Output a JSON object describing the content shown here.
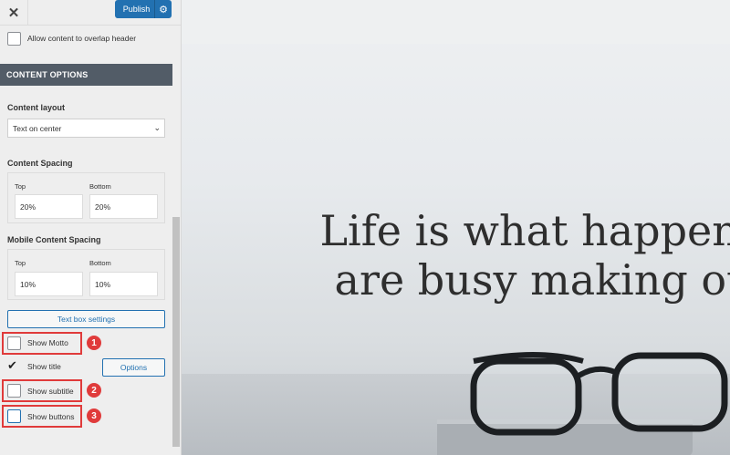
{
  "topbar": {
    "close_icon": "close-icon",
    "close_symbol": "✕",
    "publish_label": "Publish",
    "settings_icon": "gear-icon",
    "settings_symbol": "⚙"
  },
  "overlap_checkbox": {
    "label": "Allow content to overlap header",
    "checked": false
  },
  "section": {
    "title": "CONTENT OPTIONS"
  },
  "content_layout": {
    "title": "Content layout",
    "selected": "Text on center",
    "chevron": "⌄"
  },
  "content_spacing": {
    "title": "Content Spacing",
    "top_label": "Top",
    "top_value": "20%",
    "bottom_label": "Bottom",
    "bottom_value": "20%"
  },
  "mobile_spacing": {
    "title": "Mobile Content Spacing",
    "top_label": "Top",
    "top_value": "10%",
    "bottom_label": "Bottom",
    "bottom_value": "10%"
  },
  "textbox_settings_label": "Text box settings",
  "toggles": {
    "motto": {
      "label": "Show Motto",
      "checked": false,
      "badge": "1"
    },
    "title": {
      "label": "Show title",
      "checked": true,
      "options_label": "Options",
      "check_symbol": "✔"
    },
    "subtitle": {
      "label": "Show subtitle",
      "checked": false,
      "badge": "2"
    },
    "buttons": {
      "label": "Show buttons",
      "checked": false,
      "badge": "3"
    }
  },
  "preview": {
    "quote_line1": "Life is what happens w",
    "quote_line2": "are busy making othe"
  },
  "colors": {
    "accent": "#2271b1",
    "section_header": "#525c67",
    "highlight": "#e03b3b"
  }
}
